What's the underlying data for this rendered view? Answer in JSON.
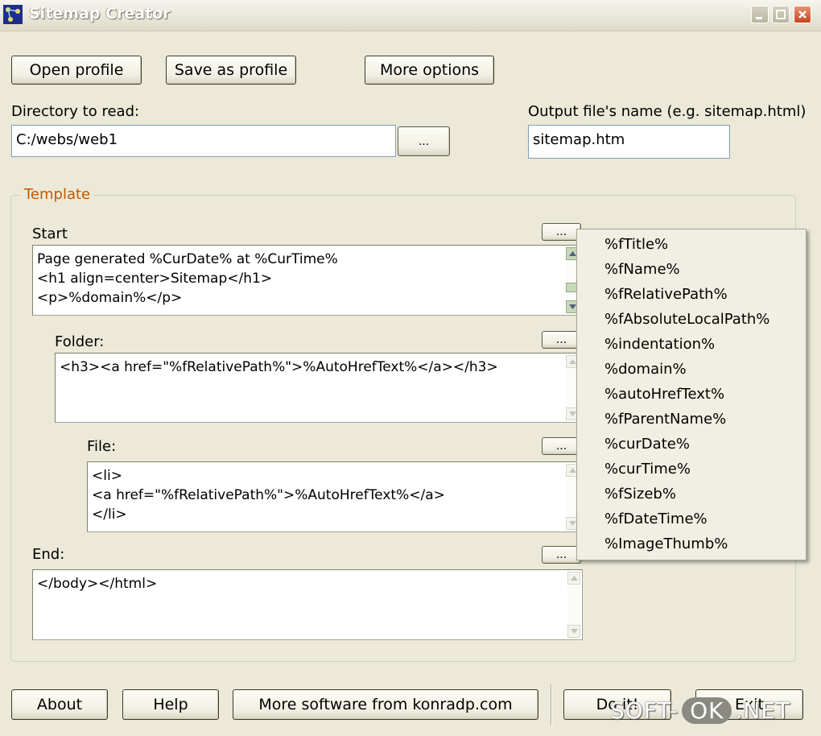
{
  "window": {
    "title": "Sitemap Creator"
  },
  "toolbar": {
    "open_profile": "Open profile",
    "save_as_profile": "Save as profile",
    "more_options": "More options"
  },
  "directory": {
    "label": "Directory to read:",
    "value": "C:/webs/web1",
    "browse_label": "..."
  },
  "output": {
    "label": "Output file's name (e.g. sitemap.html)",
    "value": "sitemap.htm"
  },
  "template": {
    "title": "Template",
    "start": {
      "label": "Start",
      "button": "...",
      "lines": [
        "Page generated %CurDate% at %CurTime%",
        "<h1 align=center>Sitemap</h1>",
        "<p>%domain%</p>"
      ]
    },
    "folder": {
      "label": "Folder:",
      "button": "...",
      "lines": [
        "<h3><a href=\"%fRelativePath%\">%AutoHrefText%</a></h3>"
      ]
    },
    "file": {
      "label": "File:",
      "button": "...",
      "lines": [
        "<li>",
        "<a href=\"%fRelativePath%\">%AutoHrefText%</a>",
        "</li>"
      ]
    },
    "end": {
      "label": "End:",
      "button": "...",
      "lines": [
        "</body></html>"
      ]
    }
  },
  "variables_menu": [
    "%fTitle%",
    "%fName%",
    "%fRelativePath%",
    "%fAbsoluteLocalPath%",
    "%indentation%",
    "%domain%",
    "%autoHrefText%",
    "%fParentName%",
    "%curDate%",
    "%curTime%",
    "%fSizeb%",
    "%fDateTime%",
    "%ImageThumb%"
  ],
  "footer": {
    "about": "About",
    "help": "Help",
    "more_software": "More software from konradp.com",
    "do_it": "Do it!",
    "exit": "Exit"
  },
  "watermark": {
    "left": "SOFT-",
    "middle": "OK",
    "right": ".NET"
  }
}
